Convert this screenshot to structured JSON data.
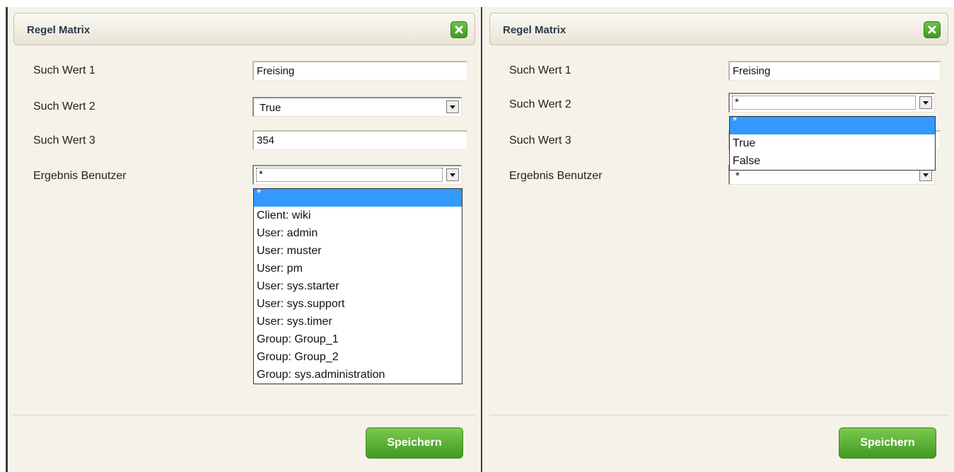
{
  "left_panel": {
    "title": "Regel Matrix",
    "fields": {
      "such_wert_1": {
        "label": "Such Wert 1",
        "value": "Freising"
      },
      "such_wert_2": {
        "label": "Such Wert 2",
        "value": "True"
      },
      "such_wert_3": {
        "label": "Such Wert 3",
        "value": "354"
      },
      "ergebnis_benutzer": {
        "label": "Ergebnis Benutzer",
        "value": "*"
      }
    },
    "dropdown_options": [
      "*",
      "Client: wiki",
      "User: admin",
      "User: muster",
      "User: pm",
      "User: sys.starter",
      "User: sys.support",
      "User: sys.timer",
      "Group: Group_1",
      "Group: Group_2",
      "Group: sys.administration"
    ],
    "save_label": "Speichern"
  },
  "right_panel": {
    "title": "Regel Matrix",
    "fields": {
      "such_wert_1": {
        "label": "Such Wert 1",
        "value": "Freising"
      },
      "such_wert_2": {
        "label": "Such Wert 2",
        "value": "*"
      },
      "such_wert_3": {
        "label": "Such Wert 3",
        "value": ""
      },
      "ergebnis_benutzer": {
        "label": "Ergebnis Benutzer",
        "value": "*"
      }
    },
    "dropdown_options": [
      "*",
      "True",
      "False"
    ],
    "save_label": "Speichern"
  },
  "icons": {
    "close": "close-x-icon",
    "dropdown_arrow": "chevron-down-icon"
  },
  "colors": {
    "accent_green": "#4caf2a",
    "selection_blue": "#3399ff",
    "panel_bg": "#f5f2ea"
  }
}
